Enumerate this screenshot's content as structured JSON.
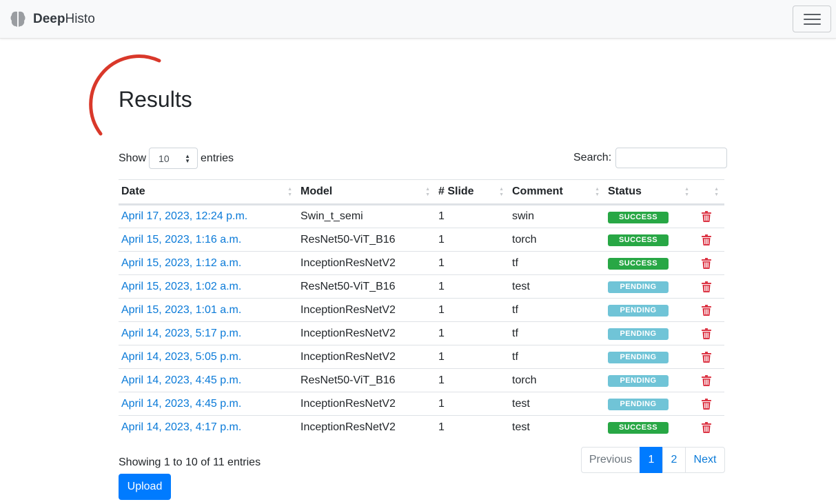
{
  "navbar": {
    "brand_bold": "Deep",
    "brand_light": "Histo",
    "logo_icon": "brain-icon",
    "toggler_icon": "hamburger-menu-icon"
  },
  "page": {
    "title": "Results",
    "accent_arc_color": "#d9382a"
  },
  "controls": {
    "show_label": "Show",
    "entries_value": "10",
    "entries_label": "entries",
    "search_label": "Search:",
    "search_value": ""
  },
  "table": {
    "headers": [
      "Date",
      "Model",
      "# Slide",
      "Comment",
      "Status",
      ""
    ],
    "rows": [
      {
        "date": "April 17, 2023, 12:24 p.m.",
        "model": "Swin_t_semi",
        "slide": "1",
        "comment": "swin",
        "status": "SUCCESS"
      },
      {
        "date": "April 15, 2023, 1:16 a.m.",
        "model": "ResNet50-ViT_B16",
        "slide": "1",
        "comment": "torch",
        "status": "SUCCESS"
      },
      {
        "date": "April 15, 2023, 1:12 a.m.",
        "model": "InceptionResNetV2",
        "slide": "1",
        "comment": "tf",
        "status": "SUCCESS"
      },
      {
        "date": "April 15, 2023, 1:02 a.m.",
        "model": "ResNet50-ViT_B16",
        "slide": "1",
        "comment": "test",
        "status": "PENDING"
      },
      {
        "date": "April 15, 2023, 1:01 a.m.",
        "model": "InceptionResNetV2",
        "slide": "1",
        "comment": "tf",
        "status": "PENDING"
      },
      {
        "date": "April 14, 2023, 5:17 p.m.",
        "model": "InceptionResNetV2",
        "slide": "1",
        "comment": "tf",
        "status": "PENDING"
      },
      {
        "date": "April 14, 2023, 5:05 p.m.",
        "model": "InceptionResNetV2",
        "slide": "1",
        "comment": "tf",
        "status": "PENDING"
      },
      {
        "date": "April 14, 2023, 4:45 p.m.",
        "model": "ResNet50-ViT_B16",
        "slide": "1",
        "comment": "torch",
        "status": "PENDING"
      },
      {
        "date": "April 14, 2023, 4:45 p.m.",
        "model": "InceptionResNetV2",
        "slide": "1",
        "comment": "test",
        "status": "PENDING"
      },
      {
        "date": "April 14, 2023, 4:17 p.m.",
        "model": "InceptionResNetV2",
        "slide": "1",
        "comment": "test",
        "status": "SUCCESS"
      }
    ],
    "delete_icon": "trash-icon",
    "status_colors": {
      "SUCCESS": "#28a745",
      "PENDING": "#70c4d7"
    }
  },
  "footer": {
    "info": "Showing 1 to 10 of 11 entries",
    "pagination": {
      "previous": "Previous",
      "pages": [
        "1",
        "2"
      ],
      "active_page": "1",
      "next": "Next"
    },
    "upload_label": "Upload"
  }
}
